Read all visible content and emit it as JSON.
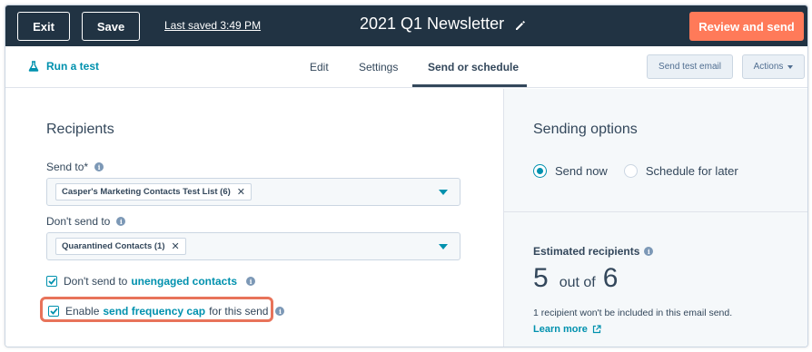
{
  "topbar": {
    "exit_label": "Exit",
    "save_label": "Save",
    "last_saved": "Last saved 3:49 PM",
    "title": "2021 Q1 Newsletter",
    "review_label": "Review and send"
  },
  "subnav": {
    "run_test": "Run a test",
    "tabs": [
      {
        "label": "Edit"
      },
      {
        "label": "Settings"
      },
      {
        "label": "Send or schedule",
        "active": true
      }
    ],
    "send_test_label": "Send test email",
    "actions_label": "Actions"
  },
  "recipients": {
    "title": "Recipients",
    "send_to_label": "Send to*",
    "send_to_tag": "Casper's Marketing Contacts Test List (6)",
    "dont_send_label": "Don't send to",
    "dont_send_tag": "Quarantined Contacts (1)",
    "unengaged_prefix": "Don't send to",
    "unengaged_link": "unengaged contacts",
    "unengaged_checked": true,
    "freq_prefix": "Enable",
    "freq_link": "send frequency cap",
    "freq_suffix": "for this send",
    "freq_checked": true
  },
  "sending": {
    "title": "Sending options",
    "send_now": "Send now",
    "schedule_later": "Schedule for later",
    "selected": "send_now",
    "estimated_label": "Estimated recipients",
    "estimated_included": "5",
    "out_of_label": "out of",
    "estimated_total": "6",
    "note": "1 recipient won't be included in this email send.",
    "learn_more": "Learn more"
  },
  "colors": {
    "topbar": "#213343",
    "accent": "#0091ae",
    "cta": "#ff7a59",
    "highlight": "#e8735a"
  },
  "icons": [
    "pencil-icon",
    "flask-icon",
    "info-icon",
    "checkmark-icon",
    "external-link-icon",
    "chevron-down-icon",
    "close-icon"
  ]
}
